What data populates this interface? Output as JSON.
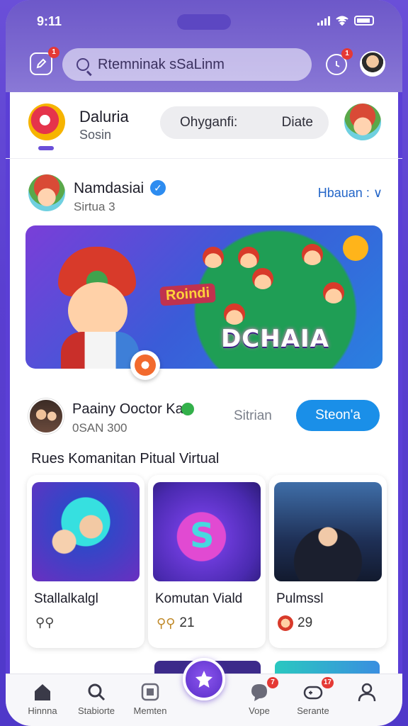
{
  "status_bar": {
    "time": "9:11"
  },
  "header": {
    "search_placeholder": "Rtemninak sSaLinm",
    "edit_badge": "1",
    "alarm_badge": "1"
  },
  "profile": {
    "name": "Daluria",
    "subtitle": "Sosin",
    "pill_left": "Ohyganfi:",
    "pill_right": "Diate"
  },
  "post": {
    "author": "Namdasiai",
    "subtitle": "Sirtua 3",
    "action": "Hbauan : ∨",
    "banner_subtitle": "Roindi",
    "banner_title": "DCHAIA"
  },
  "promo": {
    "title": "Paainy Ooctor Ka",
    "subtitle": "0SAN 300",
    "link": "Sitrian",
    "button": "Steon'a"
  },
  "section_title": "Rues Komanitan Pitual Virtual",
  "cards": [
    {
      "label": "Stallalkalgl",
      "meta": ""
    },
    {
      "label": "Komutan Viald",
      "meta": "21"
    },
    {
      "label": "Pulmssl",
      "meta": "29"
    }
  ],
  "nav": {
    "items": [
      {
        "label": "Hinnna",
        "icon": "home-icon"
      },
      {
        "label": "Stabiorte",
        "icon": "search-icon"
      },
      {
        "label": "Memten",
        "icon": "media-icon"
      },
      {
        "label": "Vope",
        "icon": "chat-icon",
        "badge": "7"
      },
      {
        "label": "Serante",
        "icon": "game-icon",
        "badge": "17"
      },
      {
        "label": "",
        "icon": "profile-icon"
      }
    ]
  },
  "colors": {
    "accent": "#6a4fd8",
    "primary_button": "#1a8fe8",
    "badge": "#e53935"
  }
}
